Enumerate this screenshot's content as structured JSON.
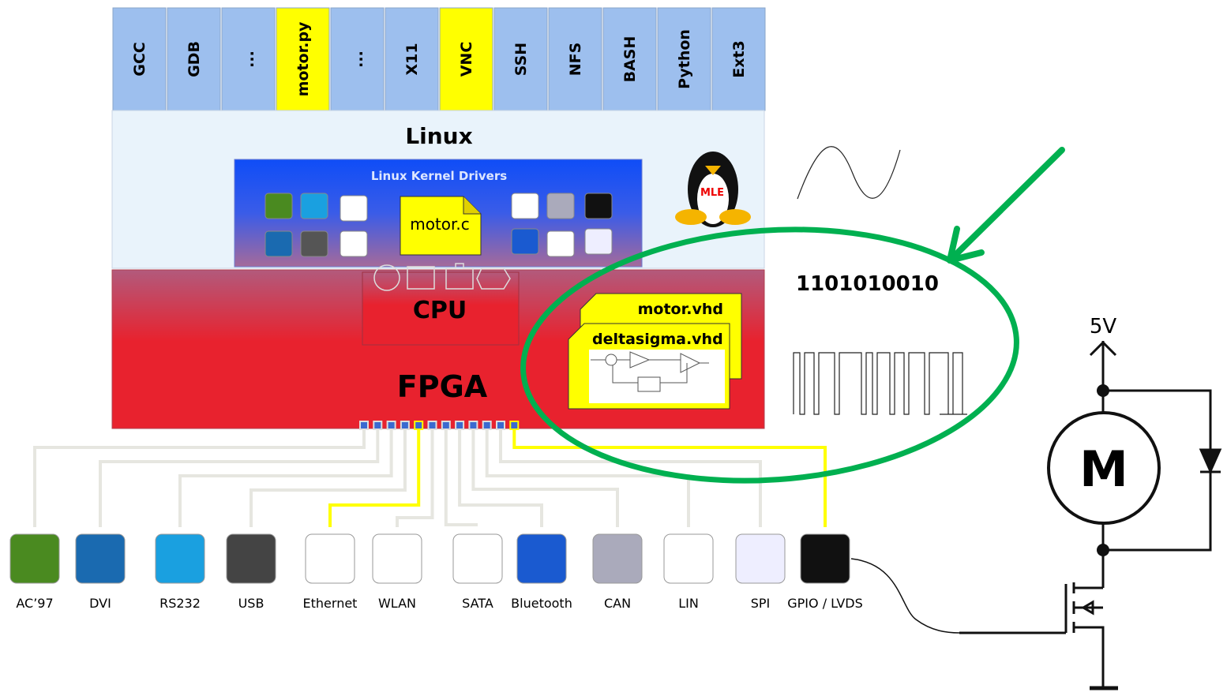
{
  "stack": {
    "apps": [
      {
        "label": "GCC",
        "highlight": false
      },
      {
        "label": "GDB",
        "highlight": false
      },
      {
        "label": "...",
        "highlight": false
      },
      {
        "label": "motor.py",
        "highlight": true
      },
      {
        "label": "...",
        "highlight": false
      },
      {
        "label": "X11",
        "highlight": false
      },
      {
        "label": "VNC",
        "highlight": true
      },
      {
        "label": "SSH",
        "highlight": false
      },
      {
        "label": "NFS",
        "highlight": false
      },
      {
        "label": "BASH",
        "highlight": false
      },
      {
        "label": "Python",
        "highlight": false
      },
      {
        "label": "Ext3",
        "highlight": false
      }
    ],
    "linux_label": "Linux",
    "kernel_drivers_label": "Linux Kernel Drivers",
    "motor_c_label": "motor.c",
    "tux_logo_text": "MLE",
    "cpu_label": "CPU",
    "fpga_label": "FPGA",
    "motor_vhd_label": "motor.vhd",
    "deltasigma_vhd_label": "deltasigma.vhd"
  },
  "peripherals": [
    {
      "label": "AC’97",
      "icon": "speaker-icon"
    },
    {
      "label": "DVI",
      "icon": "monitor-icon"
    },
    {
      "label": "RS232",
      "icon": "rs232-icon"
    },
    {
      "label": "USB",
      "icon": "usb-icon"
    },
    {
      "label": "Ethernet",
      "icon": "network-icon",
      "highlight": true
    },
    {
      "label": "WLAN",
      "icon": "wifi-icon"
    },
    {
      "label": "SATA",
      "icon": "sata-icon"
    },
    {
      "label": "Bluetooth",
      "icon": "bluetooth-icon"
    },
    {
      "label": "CAN",
      "icon": "car-icon"
    },
    {
      "label": "LIN",
      "icon": "lin-icon"
    },
    {
      "label": "SPI",
      "icon": "touch-icon"
    },
    {
      "label": "GPIO / LVDS",
      "icon": "gpio-icon",
      "highlight": true
    }
  ],
  "signals": {
    "binary": "1101010010",
    "supply": "5V",
    "motor": "M"
  },
  "colors": {
    "app_blue": "#9dbfee",
    "highlight": "#ffff00",
    "linux_bg": "#e9f3fb",
    "kernel_blue": "#1a55f0",
    "fpga_red": "#e8222e",
    "ellipse": "#00b050"
  }
}
